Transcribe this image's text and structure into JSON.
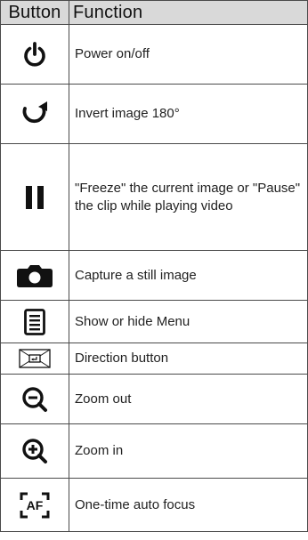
{
  "header": {
    "col1": "Button",
    "col2": "Function"
  },
  "rows": [
    {
      "icon": "power-icon",
      "text": "Power on/off"
    },
    {
      "icon": "rotate-icon",
      "text": "Invert image 180°"
    },
    {
      "icon": "pause-icon",
      "text": "\"Freeze\" the current image or \"Pause\" the clip while playing video"
    },
    {
      "icon": "camera-icon",
      "text": "Capture a still image"
    },
    {
      "icon": "menu-icon",
      "text": "Show or hide Menu"
    },
    {
      "icon": "direction-icon",
      "text": "Direction button"
    },
    {
      "icon": "zoom-out-icon",
      "text": "Zoom out"
    },
    {
      "icon": "zoom-in-icon",
      "text": "Zoom in"
    },
    {
      "icon": "auto-focus-icon",
      "text": "One-time auto focus",
      "icon_label": "AF"
    }
  ],
  "colors": {
    "header_bg": "#d9d9d9",
    "icon": "#111111",
    "border": "#4a4a4a"
  }
}
